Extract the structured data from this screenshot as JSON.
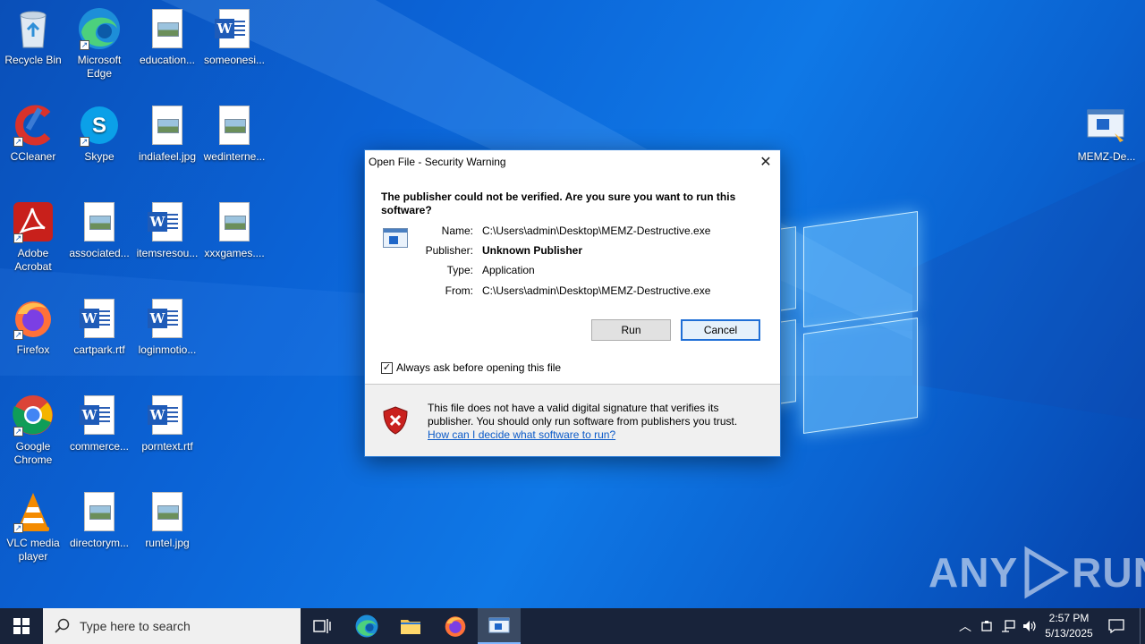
{
  "desktop": {
    "icons": [
      {
        "id": "recycle",
        "label": "Recycle Bin"
      },
      {
        "id": "edge",
        "label": "Microsoft Edge"
      },
      {
        "id": "education",
        "label": "education..."
      },
      {
        "id": "someonesi",
        "label": "someonesi..."
      },
      {
        "id": "ccleaner",
        "label": "CCleaner"
      },
      {
        "id": "skype",
        "label": "Skype"
      },
      {
        "id": "indiafeel",
        "label": "indiafeel.jpg"
      },
      {
        "id": "wedinterne",
        "label": "wedinterne..."
      },
      {
        "id": "acrobat",
        "label": "Adobe Acrobat"
      },
      {
        "id": "associated",
        "label": "associated..."
      },
      {
        "id": "itemsresou",
        "label": "itemsresou..."
      },
      {
        "id": "xxxgames",
        "label": "xxxgames...."
      },
      {
        "id": "firefox",
        "label": "Firefox"
      },
      {
        "id": "cartpark",
        "label": "cartpark.rtf"
      },
      {
        "id": "loginmotio",
        "label": "loginmotio..."
      },
      {
        "id": "chrome",
        "label": "Google Chrome"
      },
      {
        "id": "commerce",
        "label": "commerce..."
      },
      {
        "id": "porntext",
        "label": "porntext.rtf"
      },
      {
        "id": "vlc",
        "label": "VLC media player"
      },
      {
        "id": "directorym",
        "label": "directorym..."
      },
      {
        "id": "runtel",
        "label": "runtel.jpg"
      },
      {
        "id": "memz",
        "label": "MEMZ-De..."
      }
    ]
  },
  "dialog": {
    "title": "Open File - Security Warning",
    "question": "The publisher could not be verified.  Are you sure you want to run this software?",
    "name_label": "Name:",
    "name_value": "C:\\Users\\admin\\Desktop\\MEMZ-Destructive.exe",
    "publisher_label": "Publisher:",
    "publisher_value": "Unknown Publisher",
    "type_label": "Type:",
    "type_value": "Application",
    "from_label": "From:",
    "from_value": "C:\\Users\\admin\\Desktop\\MEMZ-Destructive.exe",
    "run_label": "Run",
    "cancel_label": "Cancel",
    "checkbox_label": "Always ask before opening this file",
    "checkbox_checked": true,
    "warning_text": "This file does not have a valid digital signature that verifies its publisher.  You should only run software from publishers you trust.",
    "warning_link": "How can I decide what software to run?"
  },
  "taskbar": {
    "search_placeholder": "Type here to search",
    "time": "2:57 PM",
    "date": "5/13/2025"
  },
  "watermark": {
    "text_left": "ANY",
    "text_right": "RUN"
  }
}
